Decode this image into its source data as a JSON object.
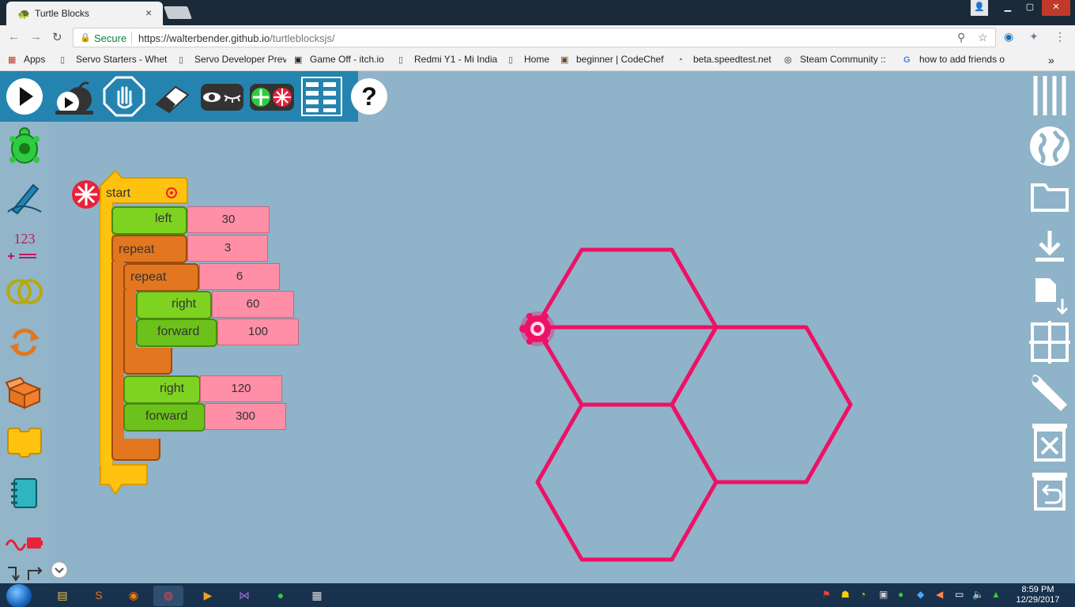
{
  "browser": {
    "tab_title": "Turtle Blocks",
    "tab_close": "×",
    "secure_label": "Secure",
    "url_domain": "https://walterbender.github.io",
    "url_path": "/turtleblocksjs/"
  },
  "bookmarks": [
    {
      "label": "Apps",
      "icon": "apps-grid-icon"
    },
    {
      "label": "Servo Starters - Whet",
      "icon": "page-icon"
    },
    {
      "label": "Servo Developer Prev",
      "icon": "page-icon"
    },
    {
      "label": "Game Off - itch.io",
      "icon": "itch-icon"
    },
    {
      "label": "Redmi Y1 - Mi India",
      "icon": "page-icon"
    },
    {
      "label": "Home",
      "icon": "page-icon"
    },
    {
      "label": "beginner | CodeChef",
      "icon": "codechef-icon"
    },
    {
      "label": "beta.speedtest.net",
      "icon": "speedtest-icon"
    },
    {
      "label": "Steam Community ::",
      "icon": "steam-icon"
    },
    {
      "label": "how to add friends o",
      "icon": "google-icon"
    }
  ],
  "bookmarks_overflow": "»",
  "program": {
    "start_label": "start",
    "left_label": "left",
    "left_value": "30",
    "repeat_label": "repeat",
    "repeat_outer_value": "3",
    "repeat_inner_value": "6",
    "right_label": "right",
    "right_inner_value": "60",
    "forward_label": "forward",
    "forward_inner_value": "100",
    "right_outer_value": "120",
    "forward_outer_value": "300"
  },
  "palette_numbers_label": "123",
  "taskbar": {
    "time": "8:59 PM",
    "date": "12/29/2017"
  },
  "colors": {
    "toolbar_blue": "#2584af",
    "canvas": "#8fb3c8",
    "pen": "#ee1166",
    "start_block": "#ffc20e",
    "flow_block": "#e2771f",
    "move_block": "#7ed321",
    "number_block": "#ff8ea7"
  }
}
